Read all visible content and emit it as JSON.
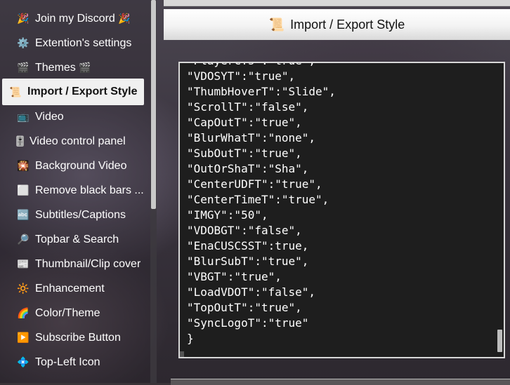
{
  "sidebar": {
    "items": [
      {
        "label": "Join my Discord",
        "icon": "party-popper-icon",
        "glyph": "🎉",
        "trailing_glyph": "🎉"
      },
      {
        "label": "Extention's settings",
        "icon": "gear-icon",
        "glyph": "⚙️"
      },
      {
        "label": "Themes",
        "icon": "film-icon",
        "glyph": "🎬",
        "trailing_glyph": "🎬"
      },
      {
        "label": "Import / Export Style",
        "icon": "scroll-icon",
        "glyph": "📜",
        "active": true
      },
      {
        "label": "Video",
        "icon": "tv-icon",
        "glyph": "📺"
      },
      {
        "label": "Video control panel",
        "icon": "remote-icon",
        "glyph": "🎚️"
      },
      {
        "label": "Background Video",
        "icon": "sparkler-icon",
        "glyph": "🎇"
      },
      {
        "label": "Remove black bars ...",
        "icon": "square-icon",
        "glyph": "⬜"
      },
      {
        "label": "Subtitles/Captions",
        "icon": "captions-icon",
        "glyph": "🔤"
      },
      {
        "label": "Topbar & Search",
        "icon": "magnifier-icon",
        "glyph": "🔎"
      },
      {
        "label": "Thumbnail/Clip cover",
        "icon": "newspaper-icon",
        "glyph": "📰"
      },
      {
        "label": "Enhancement",
        "icon": "sparkle-icon",
        "glyph": "🔆"
      },
      {
        "label": "Color/Theme",
        "icon": "rainbow-icon",
        "glyph": "🌈"
      },
      {
        "label": "Subscribe Button",
        "icon": "play-button-icon",
        "glyph": "▶️"
      },
      {
        "label": "Top-Left Icon",
        "icon": "diamond-icon",
        "glyph": "💠"
      }
    ]
  },
  "header": {
    "title": "Import / Export Style",
    "icon": "scroll-icon",
    "glyph": "📜"
  },
  "editor": {
    "content": "\"PlayerCTs\":\"true\",\n\"VDOSYT\":\"true\",\n\"ThumbHoverT\":\"Slide\",\n\"ScrollT\":\"false\",\n\"CapOutT\":\"true\",\n\"BlurWhatT\":\"none\",\n\"SubOutT\":\"true\",\n\"OutOrShaT\":\"Sha\",\n\"CenterUDFT\":\"true\",\n\"CenterTimeT\":\"true\",\n\"IMGY\":\"50\",\n\"VDOBGT\":\"false\",\n\"EnaCUSCSST\":true,\n\"BlurSubT\":\"true\",\n\"VBGT\":\"true\",\n\"LoadVDOT\":\"false\",\n\"TopOutT\":\"true\",\n\"SyncLogoT\":\"true\"\n}"
  },
  "colors": {
    "editor_bg": "#1e1e1e",
    "active_item_bg": "#f0f0f0",
    "header_bg": "#f3f3f3"
  }
}
